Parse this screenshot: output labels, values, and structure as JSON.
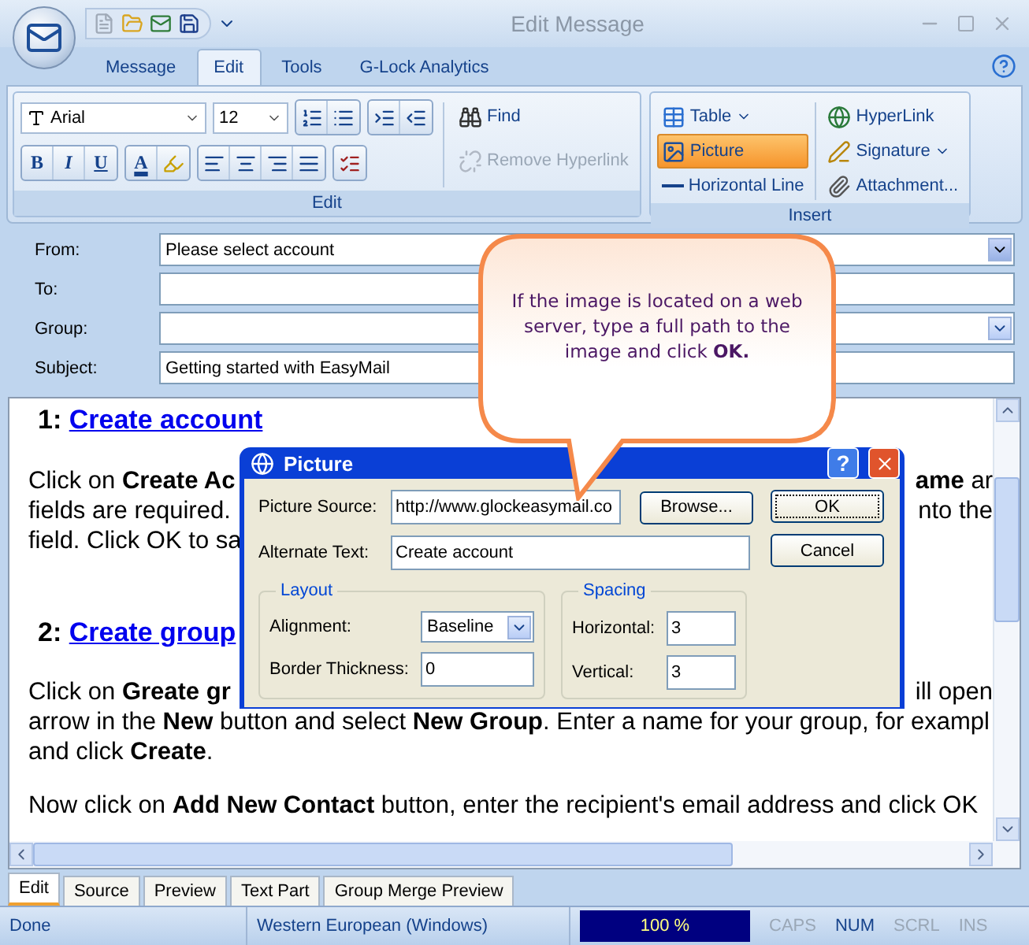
{
  "window": {
    "title": "Edit Message"
  },
  "ribbon_tabs": [
    {
      "label": "Message",
      "selected": false
    },
    {
      "label": "Edit",
      "selected": true
    },
    {
      "label": "Tools",
      "selected": false
    },
    {
      "label": "G-Lock Analytics",
      "selected": false
    }
  ],
  "ribbon": {
    "edit_group": {
      "label": "Edit",
      "font": "Arial",
      "size": "12",
      "bold": "B",
      "italic": "I",
      "underline": "U",
      "font_color": "A",
      "find": "Find",
      "remove_hyperlink": {
        "label": "Remove Hyperlink",
        "disabled": true
      }
    },
    "insert_group": {
      "label": "Insert",
      "items": [
        {
          "kind": "table",
          "label": "Table",
          "dropdown": true,
          "selected": false
        },
        {
          "kind": "picture",
          "label": "Picture",
          "dropdown": false,
          "selected": true
        },
        {
          "kind": "line",
          "label": "Horizontal Line",
          "dropdown": false,
          "selected": false
        },
        {
          "kind": "hyperlink",
          "label": "HyperLink",
          "dropdown": false,
          "selected": false
        },
        {
          "kind": "signature",
          "label": "Signature",
          "dropdown": true,
          "selected": false
        },
        {
          "kind": "attachment",
          "label": "Attachment...",
          "dropdown": false,
          "selected": false
        }
      ]
    }
  },
  "header": [
    {
      "kind": "select",
      "label": "From:",
      "value": "Please select account"
    },
    {
      "kind": "text",
      "label": "To:"
    },
    {
      "kind": "combo",
      "label": "Group:"
    },
    {
      "kind": "text",
      "label": "Subject:",
      "value": "Getting started with EasyMail"
    }
  ],
  "document": [
    {
      "kind": "heading",
      "number": "1:",
      "link": "Create account"
    },
    {
      "kind": "paragraph",
      "lines": [
        {
          "left": "Click on **Create Ac**",
          "right": "**ame** ar"
        },
        {
          "left": "fields are required.",
          "right": "nto the"
        },
        {
          "left": "field. Click OK to sa"
        }
      ]
    },
    {
      "kind": "heading",
      "number": "2:",
      "link": "Create group"
    },
    {
      "kind": "paragraph",
      "lines": [
        {
          "left": "Click on **Greate gr**",
          "right": "ill open"
        },
        {
          "left": "arrow in the **New** button and select **New Group**. Enter a name for your group, for exampl"
        },
        {
          "left": "and click **Create**."
        }
      ]
    },
    {
      "kind": "paragraph",
      "lines": [
        {
          "left": "Now click on **Add New Contact** button, enter the recipient's email address and click OK"
        }
      ]
    }
  ],
  "callout": {
    "text": "If the image is located on a web server, type a full path to the image and click **OK.**"
  },
  "dialog": {
    "title": "Picture",
    "help": "?",
    "source_label": "Picture Source:",
    "source_value": "http://www.glockeasymail.co",
    "browse": "Browse...",
    "alt_label": "Alternate Text:",
    "alt_value": "Create account",
    "ok": "OK",
    "cancel": "Cancel",
    "layout": {
      "title": "Layout",
      "alignment_label": "Alignment:",
      "alignment_value": "Baseline",
      "border_label": "Border Thickness:",
      "border_value": "0"
    },
    "spacing": {
      "title": "Spacing",
      "horizontal_label": "Horizontal:",
      "horizontal_value": "3",
      "vertical_label": "Vertical:",
      "vertical_value": "3"
    }
  },
  "view_tabs": [
    {
      "label": "Edit",
      "selected": true
    },
    {
      "label": "Source",
      "selected": false
    },
    {
      "label": "Preview",
      "selected": false
    },
    {
      "label": "Text Part",
      "selected": false
    },
    {
      "label": "Group Merge Preview",
      "selected": false
    }
  ],
  "status_bar": {
    "state": "Done",
    "encoding": "Western European (Windows)",
    "zoom": "100 %",
    "indicators": [
      {
        "label": "CAPS",
        "on": false
      },
      {
        "label": "NUM",
        "on": true
      },
      {
        "label": "SCRL",
        "on": false
      },
      {
        "label": "INS",
        "on": false
      }
    ]
  }
}
